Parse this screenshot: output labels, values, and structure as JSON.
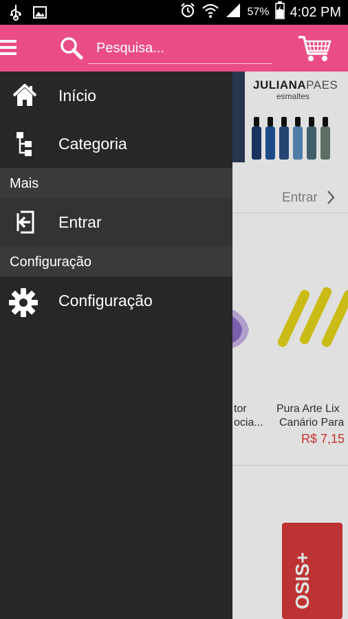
{
  "status_bar": {
    "battery_percent": "57%",
    "time": "4:02 PM",
    "icons": [
      "usb-icon",
      "image-icon",
      "alarm-icon",
      "wifi-icon",
      "signal-icon",
      "battery-icon"
    ]
  },
  "app_bar": {
    "search_placeholder": "Pesquisa...",
    "color": "#ea4d86",
    "icons": [
      "menu-icon",
      "search-icon",
      "cart-icon"
    ]
  },
  "drawer": {
    "items": [
      {
        "label": "Início",
        "icon": "home-icon"
      },
      {
        "label": "Categoria",
        "icon": "category-tree-icon"
      }
    ],
    "sections": [
      {
        "title": "Mais",
        "items": [
          {
            "label": "Entrar",
            "icon": "login-icon"
          }
        ]
      },
      {
        "title": "Configuração",
        "items": [
          {
            "label": "Configuração",
            "icon": "gear-icon"
          }
        ]
      }
    ]
  },
  "background": {
    "banner_brand": "JULIANA",
    "banner_brand_thin": "PAES",
    "banner_sub": "esmaltes",
    "entrar_label": "Entrar",
    "product_left_line1": "tor",
    "product_left_line2": "ocia...",
    "product_right_line1": "Pura Arte Lix",
    "product_right_line2": "Canário Para",
    "product_right_price": "R$ 7,15",
    "product_box_label": "OSIS+"
  }
}
